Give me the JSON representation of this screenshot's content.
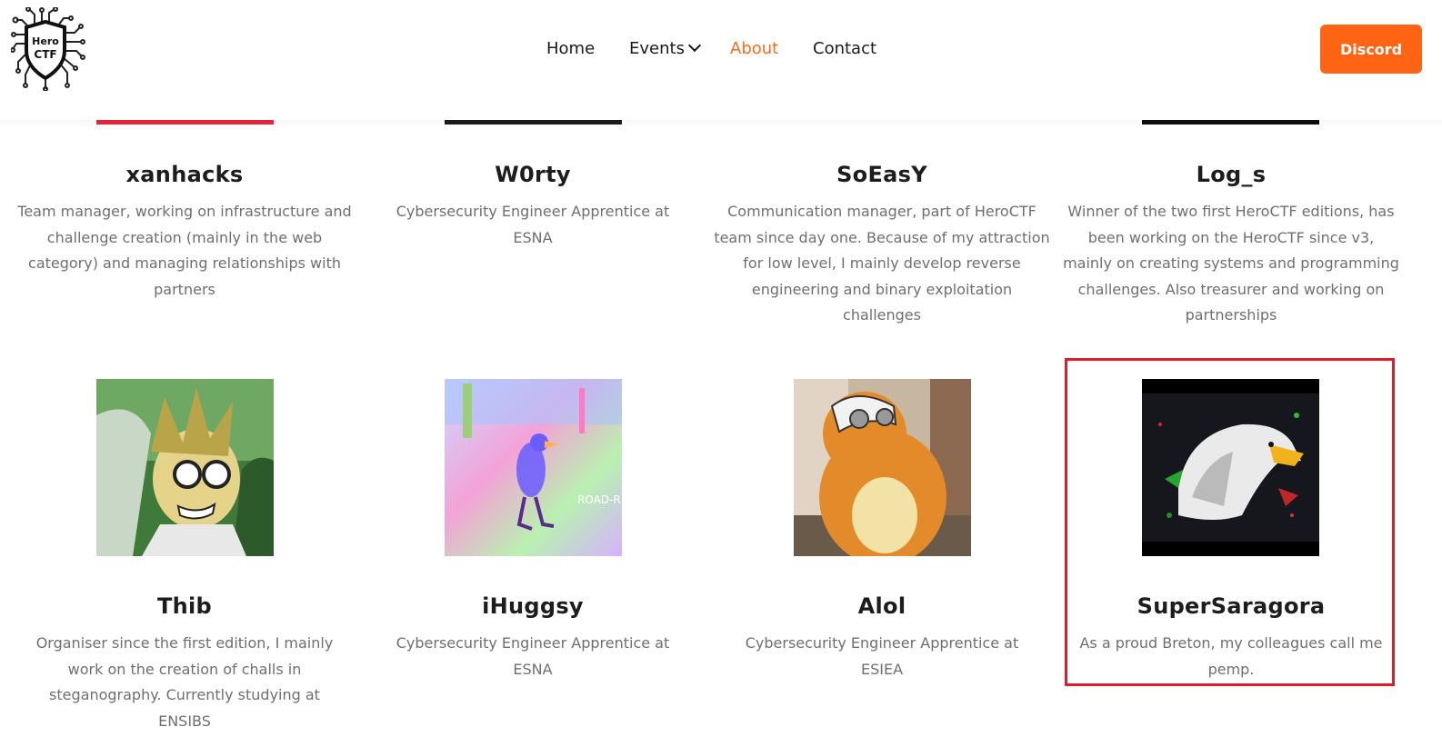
{
  "header": {
    "logo_text_top": "Hero",
    "logo_text_bottom": "CTF",
    "nav": {
      "home": "Home",
      "events": "Events",
      "about": "About",
      "contact": "Contact"
    },
    "discord_label": "Discord"
  },
  "members": [
    {
      "name": "xanhacks",
      "desc": "Team manager, working on infrastructure and challenge creation (mainly in the web category) and managing relationships with partners"
    },
    {
      "name": "W0rty",
      "desc": "Cybersecurity Engineer Apprentice at ESNA"
    },
    {
      "name": "SoEasY",
      "desc": "Communication manager, part of HeroCTF team since day one. Because of my attraction for low level, I mainly develop reverse engineering and binary exploitation challenges"
    },
    {
      "name": "Log_s",
      "desc": "Winner of the two first HeroCTF editions, has been working on the HeroCTF since v3, mainly on creating systems and programming challenges. Also treasurer and working on partnerships"
    },
    {
      "name": "Thib",
      "desc": "Organiser since the first edition, I mainly work on the creation of challs in steganography. Currently studying at ENSIBS"
    },
    {
      "name": "iHuggsy",
      "desc": "Cybersecurity Engineer Apprentice at ESNA",
      "avatar_caption": "ROAD-R"
    },
    {
      "name": "Alol",
      "desc": "Cybersecurity Engineer Apprentice at ESIEA"
    },
    {
      "name": "SuperSaragora",
      "desc": "As a proud Breton, my colleagues call me pemp."
    }
  ],
  "colors": {
    "accent": "#ff6414",
    "active_nav": "#ff6a1a",
    "highlight": "#e01b2a"
  }
}
